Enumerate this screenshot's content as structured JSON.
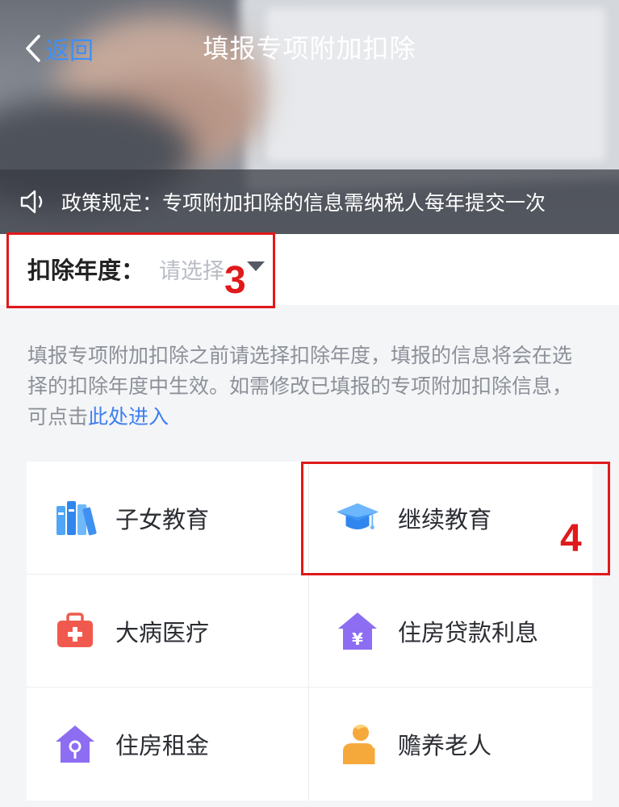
{
  "nav": {
    "back_label": "返回",
    "title": "填报专项附加扣除"
  },
  "notice": {
    "text": "政策规定：专项附加扣除的信息需纳税人每年提交一次"
  },
  "year": {
    "label": "扣除年度：",
    "placeholder": "请选择"
  },
  "hint": {
    "text": "填报专项附加扣除之前请选择扣除年度，填报的信息将会在选择的扣除年度中生效。如需修改已填报的专项附加扣除信息，可点击",
    "link": "此处进入"
  },
  "annotations": {
    "step3": "3",
    "step4": "4"
  },
  "categories": [
    {
      "label": "子女教育",
      "icon": "books-icon"
    },
    {
      "label": "继续教育",
      "icon": "graduation-cap-icon"
    },
    {
      "label": "大病医疗",
      "icon": "medical-kit-icon"
    },
    {
      "label": "住房贷款利息",
      "icon": "house-yuan-icon"
    },
    {
      "label": "住房租金",
      "icon": "house-key-icon"
    },
    {
      "label": "赡养老人",
      "icon": "elderly-person-icon"
    }
  ],
  "colors": {
    "accent": "#3e90f5",
    "highlight": "#e0191b",
    "purple": "#8d6df2",
    "red": "#f05a4e",
    "orange": "#f6a93b"
  }
}
